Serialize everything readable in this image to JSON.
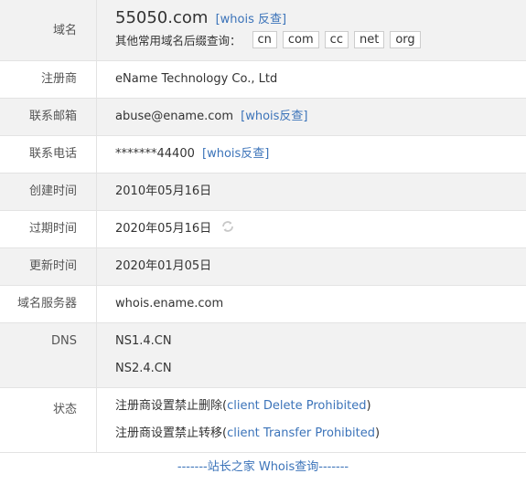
{
  "rows": {
    "domain": {
      "label": "域名",
      "name": "55050.com",
      "whois": "[whois 反查]",
      "suffix_title": "其他常用域名后缀查询：",
      "suffixes": [
        "cn",
        "com",
        "cc",
        "net",
        "org"
      ]
    },
    "registrar": {
      "label": "注册商",
      "value": "eName Technology Co., Ltd"
    },
    "email": {
      "label": "联系邮箱",
      "value": "abuse@ename.com",
      "whois": "[whois反查]"
    },
    "phone": {
      "label": "联系电话",
      "value": "*******44400",
      "whois": "[whois反查]"
    },
    "created": {
      "label": "创建时间",
      "value": "2010年05月16日"
    },
    "expires": {
      "label": "过期时间",
      "value": "2020年05月16日"
    },
    "updated": {
      "label": "更新时间",
      "value": "2020年01月05日"
    },
    "server": {
      "label": "域名服务器",
      "value": "whois.ename.com"
    },
    "dns": {
      "label": "DNS",
      "values": [
        "NS1.4.CN",
        "NS2.4.CN"
      ]
    },
    "status": {
      "label": "状态",
      "items": [
        {
          "prefix": "注册商设置禁止删除(",
          "code": "client Delete Prohibited",
          "suffix": ")"
        },
        {
          "prefix": "注册商设置禁止转移(",
          "code": "client Transfer Prohibited",
          "suffix": ")"
        }
      ]
    }
  },
  "footer": "-------站长之家 Whois查询-------",
  "colors": {
    "link": "#3b73b9",
    "label_bg": "#f2f2f2",
    "border": "#e3e3e3"
  },
  "icons": {
    "refresh": "refresh-icon"
  }
}
